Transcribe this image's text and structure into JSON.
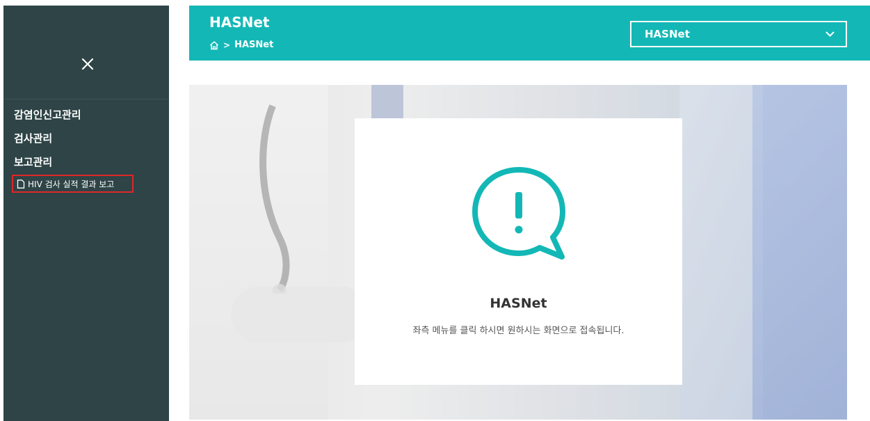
{
  "sidebar": {
    "menu": [
      {
        "label": "감염인신고관리"
      },
      {
        "label": "검사관리"
      },
      {
        "label": "보고관리"
      }
    ],
    "submenu": [
      {
        "label": "HIV 검사 실적 결과 보고"
      }
    ]
  },
  "header": {
    "title": "HASNet",
    "breadcrumb": "HASNet",
    "select_value": "HASNet"
  },
  "card": {
    "title": "HASNet",
    "message": "좌측 메뉴를 클릭 하시면 원하시는 화면으로 접속됩니다."
  },
  "colors": {
    "sidebar_bg": "#2e4446",
    "accent": "#13b8b6",
    "highlight_border": "#e0262a"
  },
  "icons": [
    "close-icon",
    "document-icon",
    "home-icon",
    "chevron-down-icon",
    "alert-speech-icon"
  ]
}
